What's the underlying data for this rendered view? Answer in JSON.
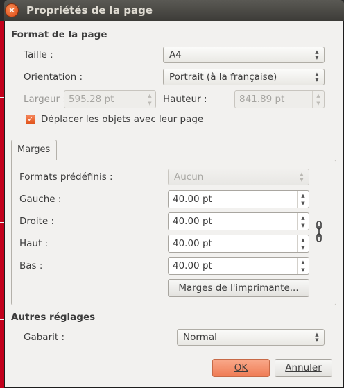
{
  "window": {
    "title": "Propriétés de la page"
  },
  "page_format": {
    "section_title": "Format de la page",
    "size_label": "Taille :",
    "size_value": "A4",
    "orientation_label": "Orientation :",
    "orientation_value": "Portrait (à la française)",
    "width_label": "Largeur :",
    "width_value": "595.28 pt",
    "height_label": "Hauteur :",
    "height_value": "841.89 pt",
    "move_objects_label": "Déplacer les objets avec leur page",
    "move_objects_checked": true
  },
  "margins": {
    "tab_label": "Marges",
    "presets_label": "Formats prédéfinis :",
    "presets_value": "Aucun",
    "left_label": "Gauche :",
    "left_value": "40.00 pt",
    "right_label": "Droite :",
    "right_value": "40.00 pt",
    "top_label": "Haut :",
    "top_value": "40.00 pt",
    "bottom_label": "Bas :",
    "bottom_value": "40.00 pt",
    "printer_margins_button": "Marges de l'imprimante..."
  },
  "other": {
    "section_title": "Autres réglages",
    "template_label": "Gabarit :",
    "template_value": "Normal"
  },
  "actions": {
    "ok_label": "OK",
    "cancel_label": "Annuler"
  },
  "colors": {
    "accent": "#ef7c55",
    "titlebar": "#3d3c38",
    "dialog_bg": "#f2f1ef"
  }
}
